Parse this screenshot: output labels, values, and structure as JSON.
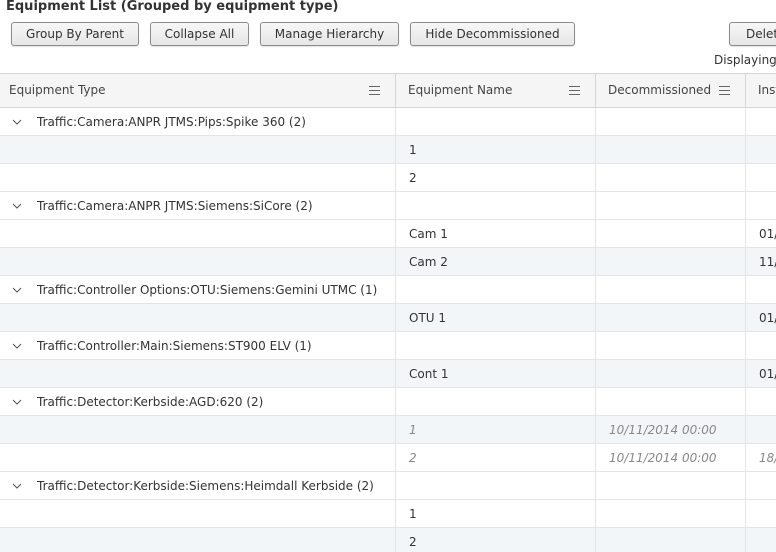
{
  "page_title": "Equipment List (Grouped by equipment type)",
  "toolbar": {
    "group_by_parent": "Group By Parent",
    "collapse_all": "Collapse All",
    "manage_hierarchy": "Manage Hierarchy",
    "hide_decommissioned": "Hide Decommissioned",
    "delete": "Delet"
  },
  "displaying": "Displaying",
  "columns": {
    "equipment_type": "Equipment Type",
    "equipment_name": "Equipment Name",
    "decommissioned": "Decommissioned",
    "inst": "Inst"
  },
  "groups": [
    {
      "label": "Traffic:Camera:ANPR JTMS:Pips:Spike 360  (2)"
    },
    {
      "label": "Traffic:Camera:ANPR JTMS:Siemens:SiCore  (2)"
    },
    {
      "label": "Traffic:Controller Options:OTU:Siemens:Gemini UTMC  (1)"
    },
    {
      "label": "Traffic:Controller:Main:Siemens:ST900 ELV  (1)"
    },
    {
      "label": "Traffic:Detector:Kerbside:AGD:620  (2)"
    },
    {
      "label": "Traffic:Detector:Kerbside:Siemens:Heimdall Kerbside  (2)"
    }
  ],
  "items": [
    {
      "name": "1",
      "decommissioned": "",
      "inst": ""
    },
    {
      "name": "2",
      "decommissioned": "",
      "inst": ""
    },
    {
      "name": "Cam 1",
      "decommissioned": "",
      "inst": "01/"
    },
    {
      "name": "Cam 2",
      "decommissioned": "",
      "inst": "11/"
    },
    {
      "name": "OTU 1",
      "decommissioned": "",
      "inst": "01/"
    },
    {
      "name": "Cont 1",
      "decommissioned": "",
      "inst": "01/"
    },
    {
      "name": "1",
      "decommissioned": "10/11/2014 00:00",
      "inst": ""
    },
    {
      "name": "2",
      "decommissioned": "10/11/2014 00:00",
      "inst": "18/"
    },
    {
      "name": "1",
      "decommissioned": "",
      "inst": ""
    },
    {
      "name": "2",
      "decommissioned": "",
      "inst": ""
    }
  ]
}
